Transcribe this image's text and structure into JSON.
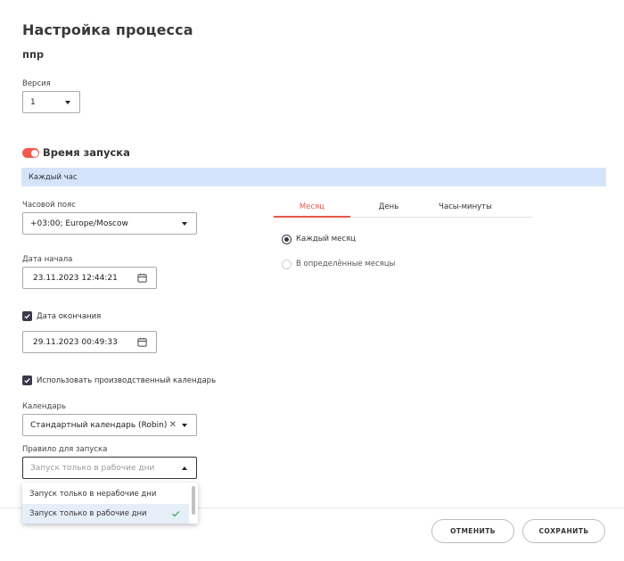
{
  "header": {
    "title": "Настройка процесса",
    "process_name": "ппр"
  },
  "version": {
    "label": "Версия",
    "value": "1"
  },
  "schedule": {
    "toggle_on": true,
    "title": "Время запуска",
    "banner": "Каждый час"
  },
  "timezone": {
    "label": "Часовой пояс",
    "value": "+03:00; Europe/Moscow"
  },
  "start_date": {
    "label": "Дата начала",
    "value": "23.11.2023 12:44:21"
  },
  "end_date": {
    "label": "Дата окончания",
    "checked": true,
    "value": "29.11.2023 00:49:33"
  },
  "calendar_toggle": {
    "label": "Использовать производственный календарь",
    "checked": true
  },
  "calendar": {
    "label": "Календарь",
    "value": "Стандартный календарь (Robin)"
  },
  "rule": {
    "label": "Правило для запуска",
    "placeholder": "Запуск только в рабочие дни",
    "options": [
      {
        "label": "Запуск только в нерабочие дни",
        "selected": false
      },
      {
        "label": "Запуск только в рабочие дни",
        "selected": true
      }
    ]
  },
  "tabs": [
    {
      "label": "Месяц",
      "active": true
    },
    {
      "label": "День",
      "active": false
    },
    {
      "label": "Часы-минуты",
      "active": false
    }
  ],
  "month_options": [
    {
      "label": "Каждый месяц",
      "selected": true
    },
    {
      "label": "В определённые месяцы",
      "selected": false
    }
  ],
  "footer": {
    "cancel_label": "ОТМЕНИТЬ",
    "save_label": "СОХРАНИТЬ"
  },
  "colors": {
    "accent": "#e8574b",
    "toggle": "#f25a4e",
    "banner_bg": "#d6e4fb",
    "check": "#3a3a4a"
  },
  "icons": {
    "select_caret": "chevron-down-icon",
    "calendar": "calendar-icon",
    "checkbox": "checkmark-icon",
    "clear": "close-icon",
    "option_check": "checkmark-icon"
  }
}
